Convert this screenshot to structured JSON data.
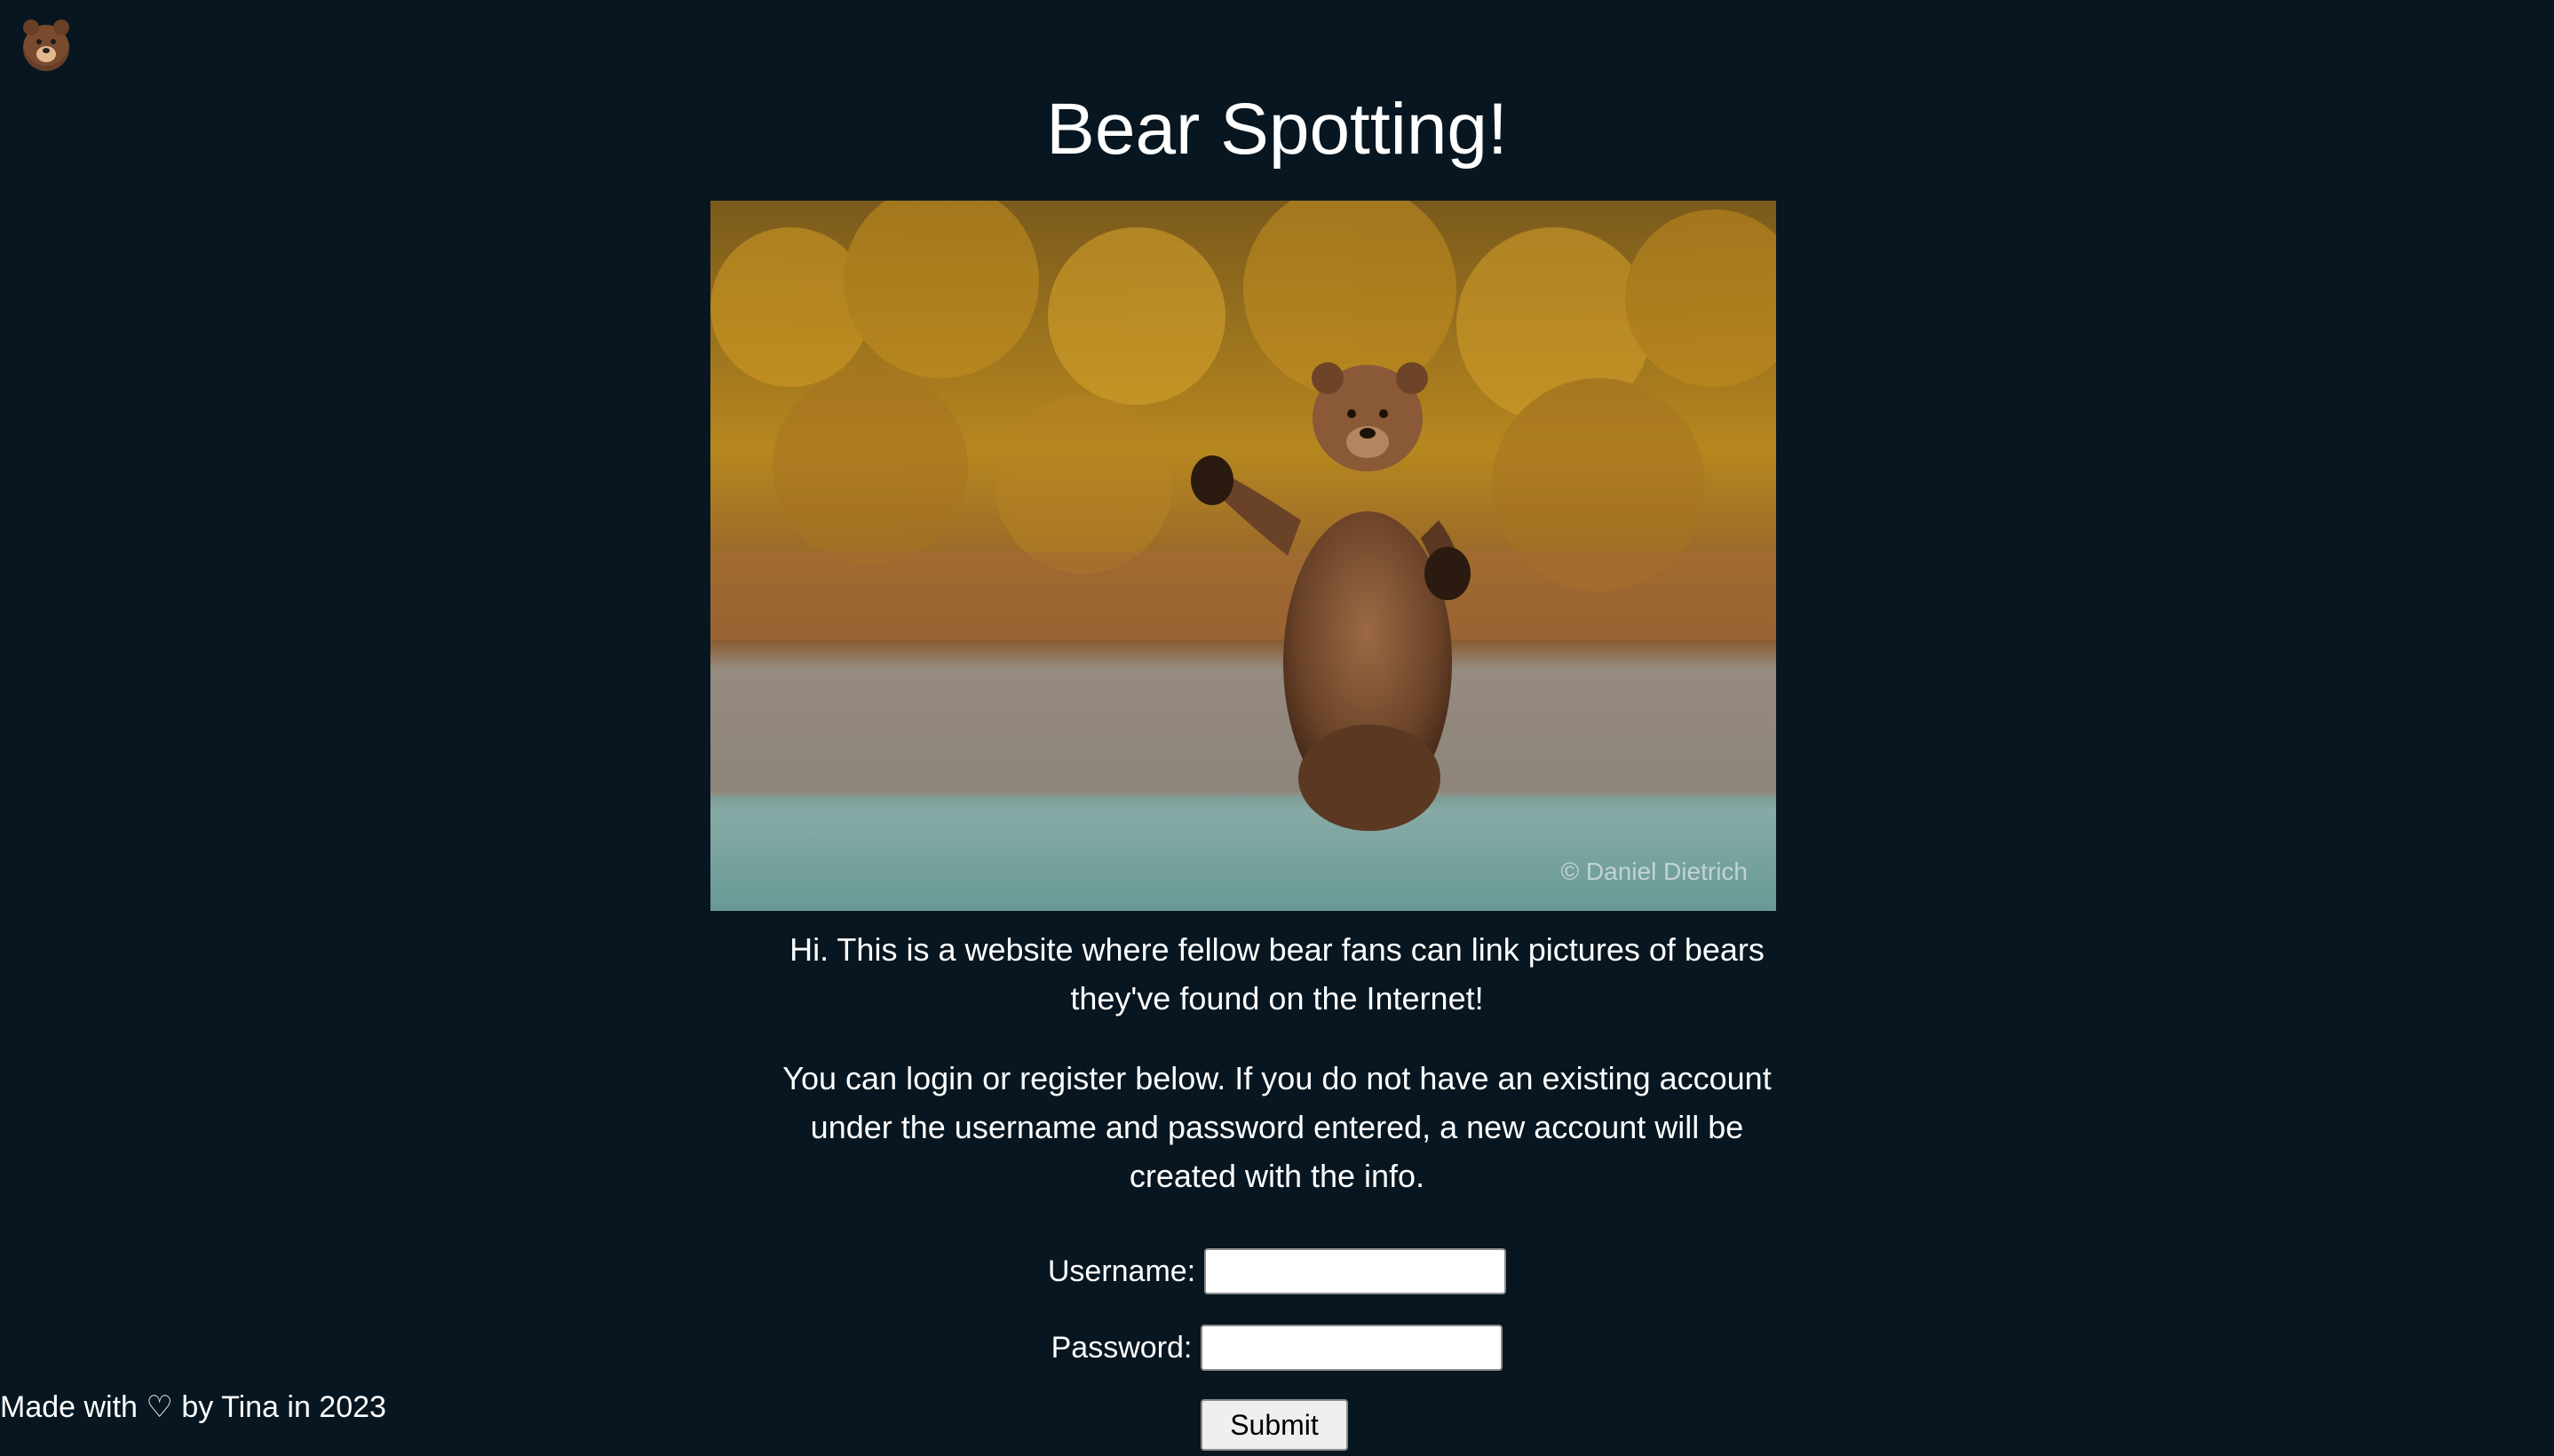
{
  "header": {
    "logo_icon": "bear-face-icon",
    "title": "Bear Spotting!"
  },
  "hero": {
    "credit": "© Daniel Dietrich"
  },
  "intro": {
    "p1": "Hi. This is a website where fellow bear fans can link pictures of bears they've found on the Internet!",
    "p2": "You can login or register below. If you do not have an existing account under the username and password entered, a new account will be created with the info."
  },
  "form": {
    "username_label": "Username:",
    "username_value": "",
    "password_label": "Password:",
    "password_value": "",
    "submit_label": "Submit"
  },
  "footer": {
    "text": "Made with ♡ by Tina in 2023"
  },
  "colors": {
    "background": "#071620",
    "text": "#ffffff"
  }
}
